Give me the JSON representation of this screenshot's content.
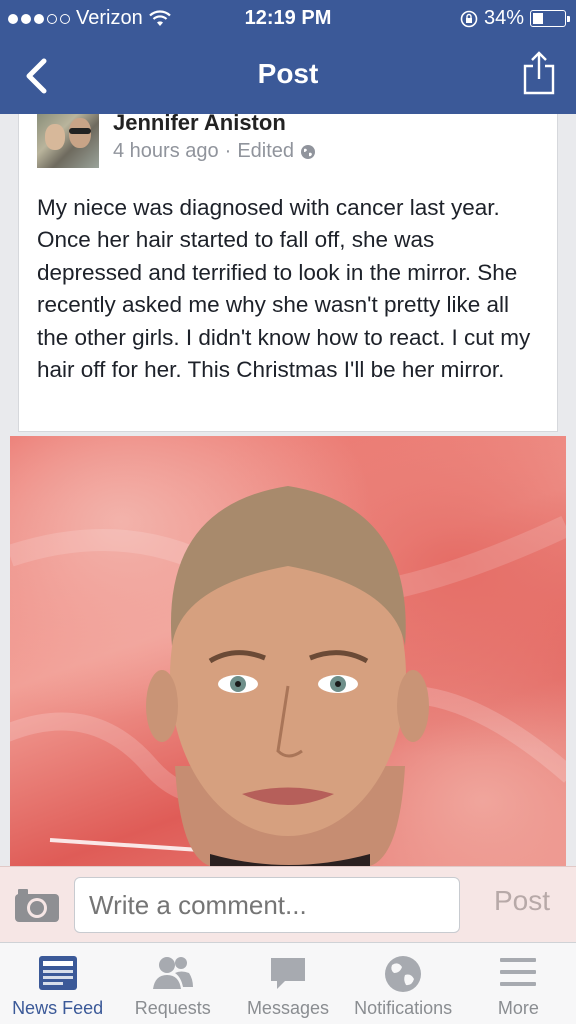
{
  "status_bar": {
    "carrier": "Verizon",
    "time": "12:19 PM",
    "battery": "34%",
    "battery_level": 0.34,
    "signal_bars_filled": 3,
    "signal_bars_total": 5
  },
  "nav": {
    "title": "Post",
    "back_icon": "chevron-left-icon",
    "share_icon": "share-icon"
  },
  "post": {
    "author": "Jennifer Aniston",
    "meta_time": "4 hours ago",
    "meta_separator": "·",
    "meta_edited": "Edited",
    "text": "My niece was diagnosed with cancer last year. Once her hair started to fall off, she was depressed and terrified to look in the mirror. She recently asked me why she wasn't pretty like all the other girls. I didn't know how to react. I cut my hair off for her. This Christmas I'll be her mirror."
  },
  "comment_bar": {
    "placeholder": "Write a comment...",
    "post_label": "Post"
  },
  "tabs": [
    {
      "label": "News Feed",
      "icon": "news-feed-icon",
      "active": true
    },
    {
      "label": "Requests",
      "icon": "requests-icon",
      "active": false
    },
    {
      "label": "Messages",
      "icon": "messages-icon",
      "active": false
    },
    {
      "label": "Notifications",
      "icon": "globe-icon",
      "active": false
    },
    {
      "label": "More",
      "icon": "menu-icon",
      "active": false
    }
  ],
  "colors": {
    "brand": "#3b5998",
    "tab_active": "#3b5998",
    "tab_inactive": "#8a8d91"
  }
}
